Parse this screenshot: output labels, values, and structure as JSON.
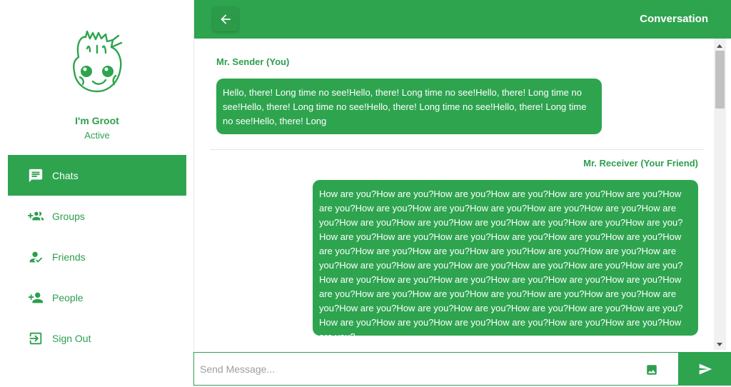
{
  "profile": {
    "name": "I'm Groot",
    "status": "Active"
  },
  "nav": {
    "items": [
      {
        "label": "Chats",
        "icon": "chat-icon",
        "active": true
      },
      {
        "label": "Groups",
        "icon": "group-add-icon",
        "active": false
      },
      {
        "label": "Friends",
        "icon": "how-to-reg-icon",
        "active": false
      },
      {
        "label": "People",
        "icon": "person-add-icon",
        "active": false
      },
      {
        "label": "Sign Out",
        "icon": "exit-to-app-icon",
        "active": false
      }
    ]
  },
  "header": {
    "title": "Conversation",
    "back_icon": "arrow-back-icon"
  },
  "messages": [
    {
      "author": "Mr. Sender (You)",
      "text": "Hello, there! Long time no see!Hello, there! Long time no see!Hello, there! Long time no see!Hello, there! Long time no see!Hello, there! Long time no see!Hello, there! Long time no see!Hello, there! Long"
    },
    {
      "author": "Mr. Receiver (Your Friend)",
      "text": "How are you?How are you?How are you?How are you?How are you?How are you?How are you?How are you?How are you?How are you?How are you?How are you?How are you?How are you?How are you?How are you?How are you?How are you?How are you?How are you?How are you?How are you?How are you?How are you?How are you?How are you?How are you?How are you?How are you?How are you?How are you?How are you?How are you?How are you?How are you?How are you?How are you?How are you?How are you?How are you?How are you?How are you?How are you?How are you?How are you?How are you?How are you?How are you?How are you?How are you?How are you?How are you?How are you?How are you?How are you?How are you?How are you?How are you?How are you?How are you?How are you?How are you?How are you?How are you?"
    }
  ],
  "composer": {
    "placeholder": "Send Message...",
    "value": "",
    "image_icon": "image-icon",
    "send_icon": "send-icon"
  },
  "colors": {
    "accent": "#2ea44f",
    "accent_text": "#2e9e4e"
  }
}
